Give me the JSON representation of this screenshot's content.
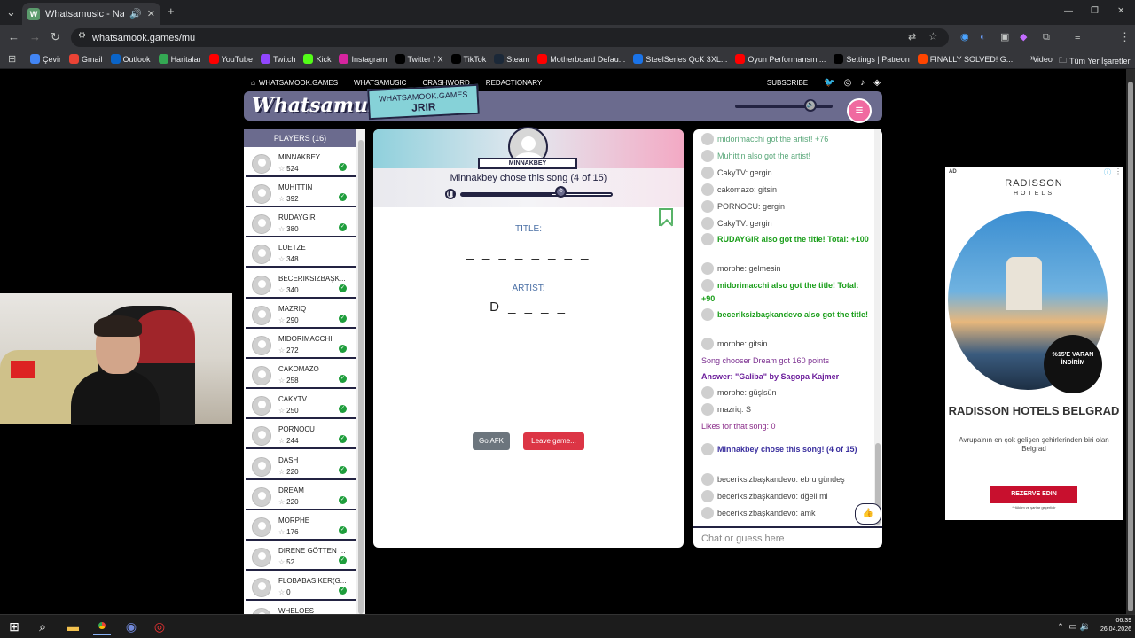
{
  "browser": {
    "tab_title": "Whatsamusic - Name That",
    "url": "whatsamook.games/mu",
    "bookmarks": [
      {
        "label": "Çevir",
        "icon": "translate-icon",
        "color": "#4285f4"
      },
      {
        "label": "Gmail",
        "icon": "gmail-icon",
        "color": "#ea4335"
      },
      {
        "label": "Outlook",
        "icon": "outlook-icon",
        "color": "#0a64c8"
      },
      {
        "label": "Haritalar",
        "icon": "maps-icon",
        "color": "#34a853"
      },
      {
        "label": "YouTube",
        "icon": "youtube-icon",
        "color": "#ff0000"
      },
      {
        "label": "Twitch",
        "icon": "twitch-icon",
        "color": "#9146ff"
      },
      {
        "label": "Kick",
        "icon": "kick-icon",
        "color": "#53fc18"
      },
      {
        "label": "Instagram",
        "icon": "instagram-icon",
        "color": "#d6249f"
      },
      {
        "label": "Twitter / X",
        "icon": "x-icon",
        "color": "#000000"
      },
      {
        "label": "TikTok",
        "icon": "tiktok-icon",
        "color": "#000000"
      },
      {
        "label": "Steam",
        "icon": "steam-icon",
        "color": "#1b2838"
      },
      {
        "label": "Motherboard Defau...",
        "icon": "youtube-icon",
        "color": "#ff0000"
      },
      {
        "label": "SteelSeries QcK 3XL...",
        "icon": "steelseries-icon",
        "color": "#1a73e8"
      },
      {
        "label": "Oyun Performansını...",
        "icon": "youtube-icon",
        "color": "#ff0000"
      },
      {
        "label": "Settings | Patreon",
        "icon": "patreon-icon",
        "color": "#000000"
      },
      {
        "label": "FINALLY SOLVED! G...",
        "icon": "reddit-icon",
        "color": "#ff4500"
      },
      {
        "label": "video",
        "icon": "folder-icon",
        "color": "#35363a"
      }
    ],
    "all_bookmarks": "Tüm Yer İşaretleri"
  },
  "site": {
    "nav": [
      "WHATSAMOOK.GAMES",
      "WHATSAMUSIC",
      "CRASHWORD",
      "REDACTIONARY"
    ],
    "subscribe": "SUBSCRIBE",
    "logo": "Whatsamusic",
    "tag_line1": "WHATSAMOOK.GAMES",
    "tag_line2": "JRIR"
  },
  "players": {
    "header": "PLAYERS (16)",
    "list": [
      {
        "name": "MINNAKBEY",
        "score": "524",
        "checked": true
      },
      {
        "name": "MUHITTIN",
        "score": "392",
        "checked": true
      },
      {
        "name": "RUDAYGIR",
        "score": "380",
        "checked": true
      },
      {
        "name": "LUETZE",
        "score": "348",
        "checked": false
      },
      {
        "name": "BECERIKSIZBAŞK...",
        "score": "340",
        "checked": true
      },
      {
        "name": "MAZRIQ",
        "score": "290",
        "checked": true
      },
      {
        "name": "MIDORIMACCHI",
        "score": "272",
        "checked": true
      },
      {
        "name": "CAKOMAZO",
        "score": "258",
        "checked": true
      },
      {
        "name": "CAKYTV",
        "score": "250",
        "checked": true
      },
      {
        "name": "PORNOCU",
        "score": "244",
        "checked": true
      },
      {
        "name": "DASH",
        "score": "220",
        "checked": true
      },
      {
        "name": "DREAM",
        "score": "220",
        "checked": true
      },
      {
        "name": "MORPHE",
        "score": "176",
        "checked": true
      },
      {
        "name": "DIRENE GÖTTEN S...",
        "score": "52",
        "checked": true
      },
      {
        "name": "FLOBABASİKER(G...",
        "score": "0",
        "checked": true
      },
      {
        "name": "WHELOES",
        "score": "",
        "checked": false
      }
    ]
  },
  "game": {
    "chooser": "MINNAKBEY",
    "status": "Minnakbey chose this song (4 of 15)",
    "progress": 0.6,
    "title_label": "TITLE:",
    "title_blanks": "_ _ _ _ _ _ _ _",
    "artist_label": "ARTIST:",
    "artist_blanks": "D _ _ _ _",
    "afk_button": "Go AFK",
    "leave_button": "Leave game..."
  },
  "chat": {
    "messages": [
      {
        "text": "midorimacchi got the artist! +76",
        "style": "c-teal",
        "avatar": true
      },
      {
        "text": "Muhittin also got the artist!",
        "style": "c-teal",
        "avatar": true
      },
      {
        "text": "CakyTV: gergin",
        "style": "c-gray",
        "avatar": true
      },
      {
        "text": "cakomazo: gitsin",
        "style": "c-gray",
        "avatar": true
      },
      {
        "text": "PORNOCU: gergin",
        "style": "c-gray",
        "avatar": true
      },
      {
        "text": "CakyTV: gergin",
        "style": "c-gray",
        "avatar": true
      },
      {
        "text": "RUDAYGIR also got the title! Total: +100",
        "style": "c-green",
        "avatar": true
      },
      {
        "text": "morphe: gelmesin",
        "style": "c-gray",
        "avatar": true
      },
      {
        "text": "midorimacchi also got the title! Total: +90",
        "style": "c-green",
        "avatar": true
      },
      {
        "text": "beceriksizbaşkandevo also got the title!",
        "style": "c-green",
        "avatar": true
      },
      {
        "text": "morphe: gitsin",
        "style": "c-gray",
        "avatar": true
      },
      {
        "text": "Song chooser Dream got 160 points",
        "style": "c-purple",
        "avatar": false
      },
      {
        "text": "Answer: \"Galiba\" by Sagopa Kajmer",
        "style": "c-bold-purple",
        "avatar": false
      },
      {
        "text": "morphe: güşlsün",
        "style": "c-gray",
        "avatar": true
      },
      {
        "text": "mazriq: S",
        "style": "c-gray",
        "avatar": true
      },
      {
        "text": "Likes for that song: 0",
        "style": "c-pinkish",
        "avatar": false
      },
      {
        "text": "Minnakbey chose this song! (4 of 15)",
        "style": "c-blue-bold",
        "avatar": true
      },
      {
        "text": "beceriksizbaşkandevo: ebru gündeş",
        "style": "c-gray",
        "avatar": true
      },
      {
        "text": "beceriksizbaşkandevo: dğeil mi",
        "style": "c-gray",
        "avatar": true
      },
      {
        "text": "beceriksizbaşkandevo: amk",
        "style": "c-gray",
        "avatar": true
      }
    ],
    "input_placeholder": "Chat or guess here"
  },
  "ad": {
    "label": "AD",
    "brand": "RADISSON",
    "brand_sub": "HOTELS",
    "badge": "%15'E VARAN İNDİRİM",
    "title": "RADISSON HOTELS BELGRAD",
    "subtitle": "Avrupa'nın en çok gelişen şehirlerinden biri olan Belgrad",
    "button": "REZERVE EDIN",
    "fine": "*Hüküm ve şartlar geçerlidir"
  },
  "taskbar": {
    "time": "06:39",
    "date": "26.04.2026"
  }
}
